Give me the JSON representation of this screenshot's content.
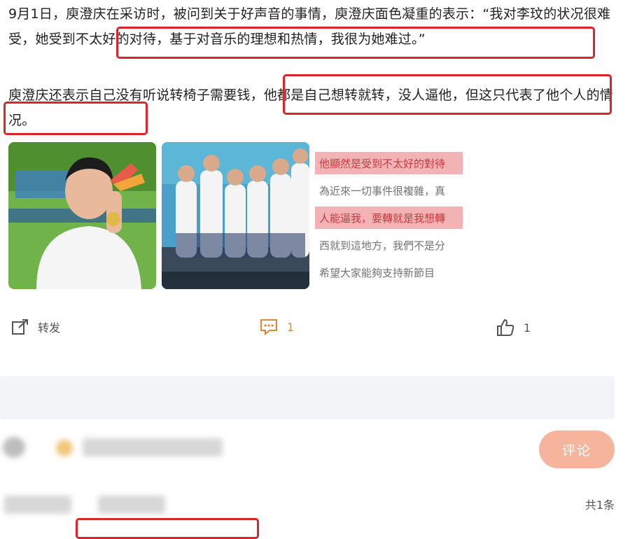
{
  "article": {
    "para1_part1": "9月1日，庾澄庆在采访时，被问到关于好声音的事情，庾澄庆面色凝重的表示：“我对李玟的状况很难受，",
    "para1_part2": "她受到不太好的对待，基于对音乐的理想和热情，我很为她难过。”",
    "para2_part1": "庾澄庆还表示自己没有听说转椅子需要钱，",
    "para2_part2": "他都是自己想转就转，没人逼他，但这只代表了他个人的情况。"
  },
  "gallery": {
    "image3_lines": [
      "他顯然是受到不太好的對待",
      "為近來一切事件很複雜，真",
      "人能逼我，要轉就是我想轉",
      "西就到這地方，我們不是分",
      "希望大家能夠支持新節目"
    ]
  },
  "actions": {
    "share_label": "转发",
    "comment_count": "1",
    "like_count": "1"
  },
  "comment": {
    "submit_label": "评论",
    "total_label": "共1条"
  },
  "colors": {
    "highlight": "#d9262d",
    "accent": "#e2872c",
    "button": "#f7b49d"
  }
}
